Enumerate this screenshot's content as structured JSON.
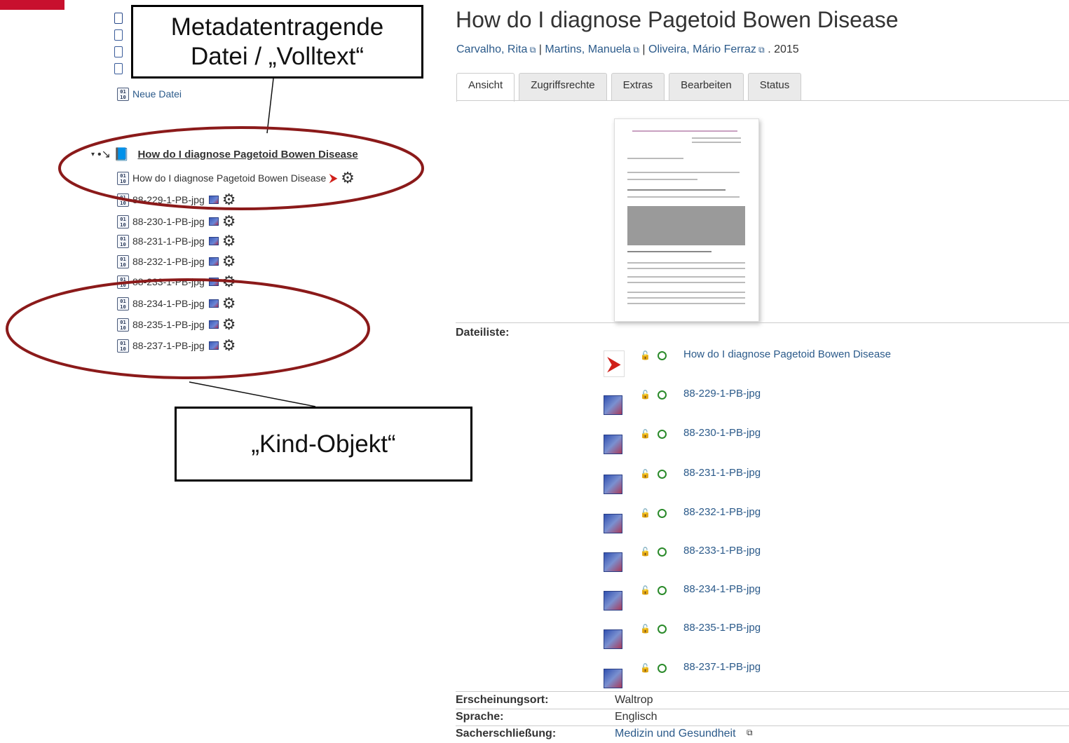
{
  "tree": {
    "new_file_label": "Neue Datei",
    "root_label": "How do I diagnose Pagetoid Bowen Disease",
    "items": [
      {
        "label": "How do I diagnose Pagetoid Bowen Disease",
        "type": "pdf"
      },
      {
        "label": "88-229-1-PB-jpg",
        "type": "image"
      },
      {
        "label": "88-230-1-PB-jpg",
        "type": "image"
      },
      {
        "label": "88-231-1-PB-jpg",
        "type": "image"
      },
      {
        "label": "88-232-1-PB-jpg",
        "type": "image"
      },
      {
        "label": "88-233-1-PB-jpg",
        "type": "image"
      },
      {
        "label": "88-234-1-PB-jpg",
        "type": "image"
      },
      {
        "label": "88-235-1-PB-jpg",
        "type": "image"
      },
      {
        "label": "88-237-1-PB-jpg",
        "type": "image"
      }
    ]
  },
  "annotations": {
    "top_line1": "Metadatentragende",
    "top_line2": "Datei / „Volltext“",
    "bottom": "„Kind-Objekt“",
    "accent_color": "#8b1a1a"
  },
  "record": {
    "title": "How do I diagnose Pagetoid Bowen Disease",
    "authors": [
      "Carvalho, Rita",
      "Martins, Manuela",
      "Oliveira, Mário Ferraz"
    ],
    "year": ". 2015",
    "tabs": [
      "Ansicht",
      "Zugriffsrechte",
      "Extras",
      "Bearbeiten",
      "Status"
    ],
    "active_tab": "Ansicht",
    "filelist_label": "Dateiliste:",
    "files": [
      {
        "label": "How do I diagnose Pagetoid Bowen Disease",
        "type": "pdf"
      },
      {
        "label": "88-229-1-PB-jpg",
        "type": "image"
      },
      {
        "label": "88-230-1-PB-jpg",
        "type": "image"
      },
      {
        "label": "88-231-1-PB-jpg",
        "type": "image"
      },
      {
        "label": "88-232-1-PB-jpg",
        "type": "image"
      },
      {
        "label": "88-233-1-PB-jpg",
        "type": "image"
      },
      {
        "label": "88-234-1-PB-jpg",
        "type": "image"
      },
      {
        "label": "88-235-1-PB-jpg",
        "type": "image"
      },
      {
        "label": "88-237-1-PB-jpg",
        "type": "image"
      }
    ],
    "meta": [
      {
        "key": "Erscheinungsort:",
        "value": "Waltrop",
        "link": false
      },
      {
        "key": "Sprache:",
        "value": "Englisch",
        "link": false
      },
      {
        "key": "Sacherschließung:",
        "value": "Medizin und Gesundheit",
        "link": true
      }
    ]
  },
  "colors": {
    "link": "#2b5a8a",
    "brand_red": "#c8102e",
    "access_green": "#2a8a2a"
  }
}
